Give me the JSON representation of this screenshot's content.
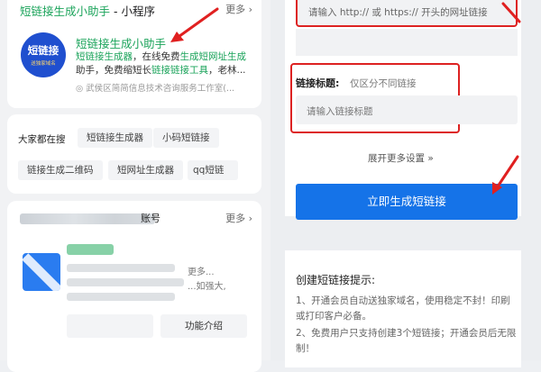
{
  "left": {
    "miniprogram": {
      "title_green": "短链接生成小助手",
      "title_suffix": " - 小程序",
      "more": "更多 ›",
      "logo_main": "短链接",
      "logo_sub": "送独家域名",
      "app_name": "短链接生成小助手",
      "desc_prefix": "短链接生成器",
      "desc_mid": "，在线免费",
      "desc_green": "生成短网址生成",
      "desc_line2_prefix": "助手，免费缩短长",
      "desc_line2_green": "链接链接工具",
      "desc_line2_tail": "，老林...",
      "source": "◎ 武侯区简简信息技术咨询服务工作室(..."
    },
    "search": {
      "title": "大家都在搜",
      "chips": [
        "短链接生成器",
        "小码短链接",
        "链接生成二维码",
        "短网址生成器",
        "qq短链"
      ]
    },
    "account": {
      "suffix": "账号",
      "more": "更多 ›",
      "tail1": "更多...",
      "tail2": "...如强大,",
      "func_button": "功能介绍"
    }
  },
  "right": {
    "url_placeholder": "请输入 http:// 或 https:// 开头的网址链接",
    "label_title": "链接标题:",
    "label_hint": "仅区分不同链接",
    "title_placeholder": "请输入链接标题",
    "expand_label": "展开更多设置 »",
    "generate_button": "立即生成短链接",
    "tips_title": "创建短链接提示:",
    "tips": [
      "1、开通会员自动送独家域名，使用稳定不封！印刷或打印客户必备。",
      "2、免费用户只支持创建3个短链接；开通会员后无限制！"
    ]
  },
  "colors": {
    "accent_blue": "#1573e8",
    "brand_green": "#1aa35a",
    "highlight_red": "#dd2222"
  }
}
